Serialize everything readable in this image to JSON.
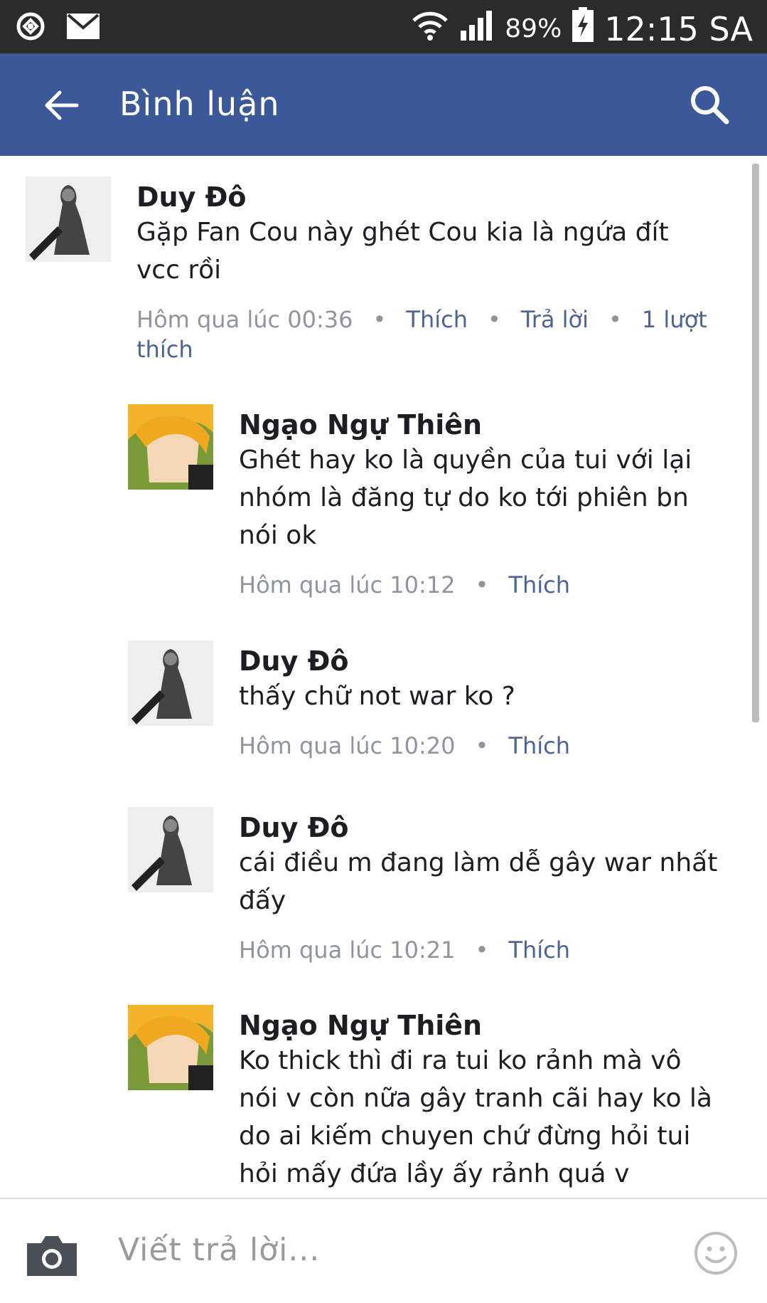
{
  "status_bar": {
    "battery_percent": "89%",
    "time": "12:15 SA",
    "icons": [
      "sync-icon",
      "mail-icon",
      "wifi-icon",
      "signal-icon",
      "battery-charging-icon"
    ]
  },
  "app_bar": {
    "title": "Bình luận",
    "back_icon": "arrow-left-icon",
    "search_icon": "search-icon",
    "color": "#3b5998"
  },
  "comments": [
    {
      "author": "Duy Đô",
      "text": "Gặp Fan Cou này ghét Cou kia là ngứa đít vcc rồi",
      "time": "Hôm qua lúc 00:36",
      "like_label": "Thích",
      "reply_label": "Trả lời",
      "likes_label": "1 lượt thích"
    },
    {
      "author": "Ngạo Ngự Thiên",
      "text": "Ghét hay ko là quyền của tui với lại nhóm là đăng tự do ko tới phiên bn nói ok",
      "time": "Hôm qua lúc 10:12",
      "like_label": "Thích"
    },
    {
      "author": "Duy Đô",
      "text": "thấy chữ not war ko ?",
      "time": "Hôm qua lúc 10:20",
      "like_label": "Thích"
    },
    {
      "author": "Duy Đô",
      "text": "cái điều m đang làm dễ gây war nhất đấy",
      "time": "Hôm qua lúc 10:21",
      "like_label": "Thích"
    },
    {
      "author": "Ngạo Ngự Thiên",
      "text": "Ko thick thì đi ra tui ko rảnh mà vô nói v còn nữa gây tranh cãi hay ko là do ai kiếm chuyen chứ đừng hỏi tui hỏi mấy đứa lầy ấy rảnh quá v"
    }
  ],
  "composer": {
    "placeholder": "Viết trả lời...",
    "camera_icon": "camera-icon",
    "emoji_icon": "smiley-icon"
  }
}
